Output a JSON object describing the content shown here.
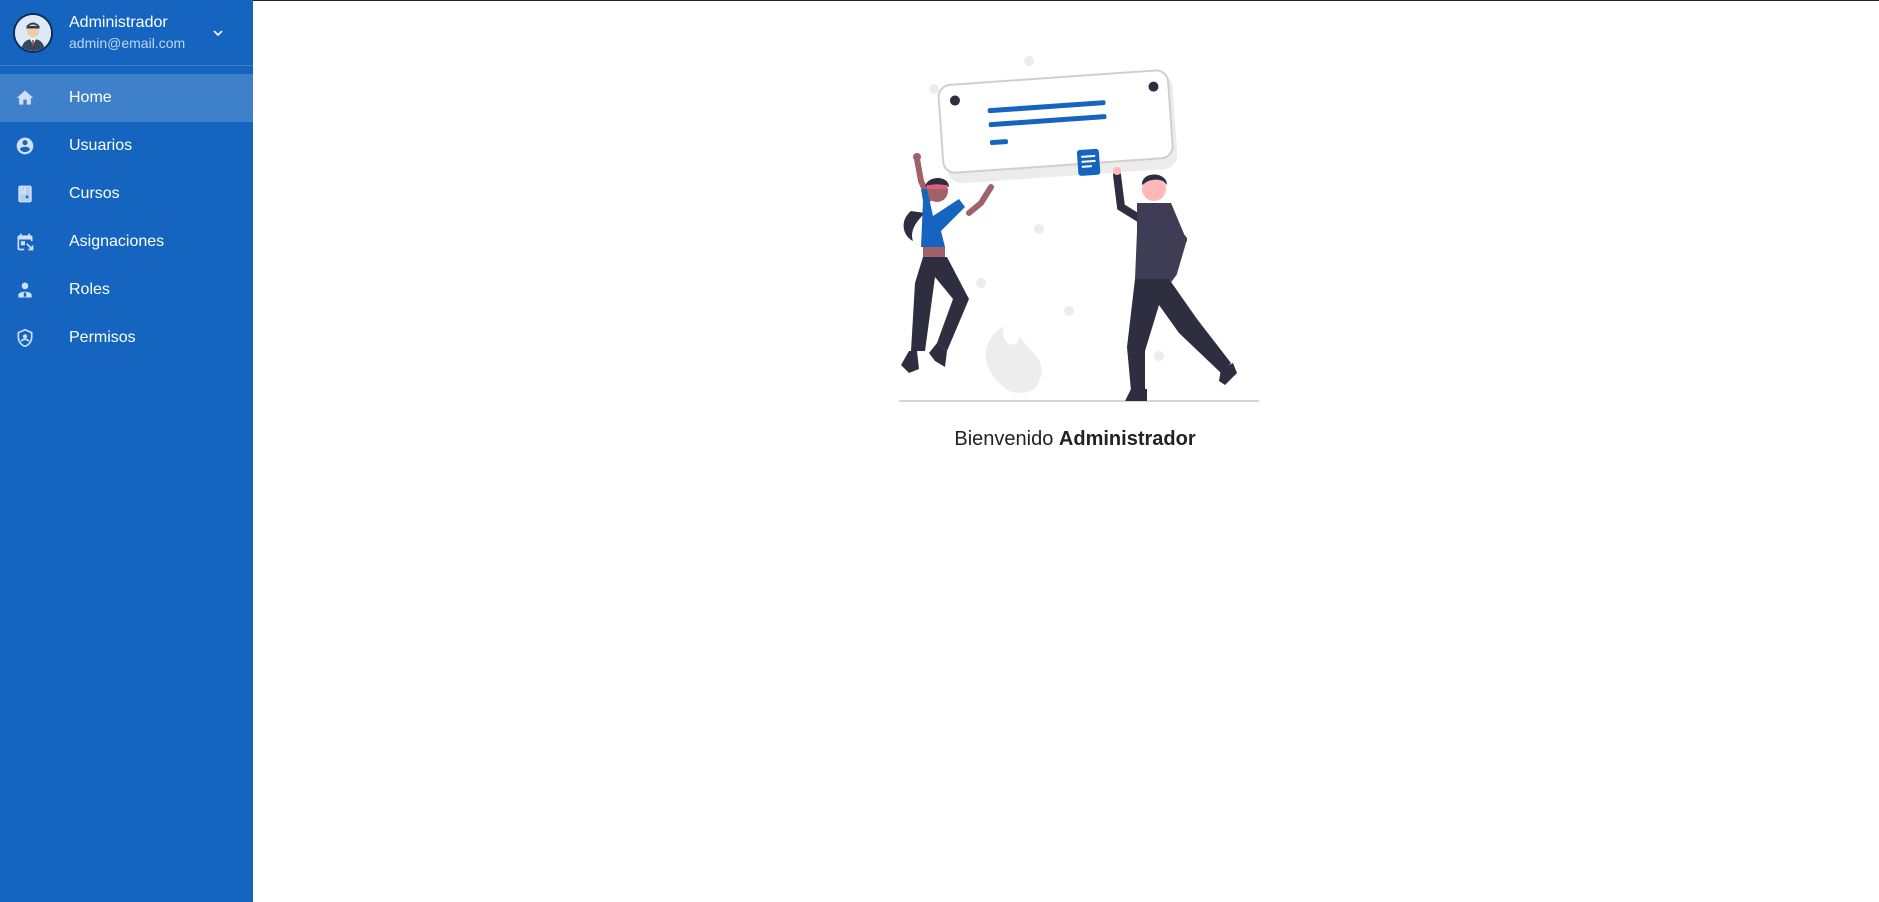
{
  "user": {
    "name": "Administrador",
    "email": "admin@email.com"
  },
  "nav": {
    "items": [
      {
        "label": "Home",
        "icon": "home-icon"
      },
      {
        "label": "Usuarios",
        "icon": "account-circle-icon"
      },
      {
        "label": "Cursos",
        "icon": "book-icon"
      },
      {
        "label": "Asignaciones",
        "icon": "calendar-assign-icon"
      },
      {
        "label": "Roles",
        "icon": "badge-icon"
      },
      {
        "label": "Permisos",
        "icon": "shield-account-icon"
      }
    ],
    "active_index": 0
  },
  "main": {
    "welcome_prefix": "Bienvenido",
    "welcome_name": "Administrador"
  },
  "colors": {
    "sidebar": "#1565c0",
    "accent": "#1565c0",
    "figure_dark": "#2f2e41"
  }
}
